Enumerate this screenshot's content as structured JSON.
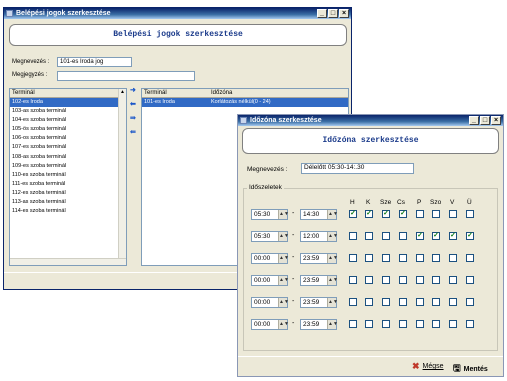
{
  "back_window": {
    "title": "Belépési jogok szerkesztése",
    "header": "Belépési jogok szerkesztése",
    "name_label": "Megnevezés :",
    "name_value": "101-es Iroda jog",
    "note_label": "Megjegyzés :",
    "note_value": "",
    "left_list": {
      "header": "Terminál",
      "items": [
        "102-es Iroda",
        "103-as szoba terminál",
        "104-es szoba terminál",
        "105-ös szoba terminál",
        "106-os szoba terminál",
        "107-es szoba terminál",
        "108-as szoba terminál",
        "109-es szoba terminál",
        "110-es szoba terminál",
        "111-es szoba terminál",
        "112-es szoba terminál",
        "113-as szoba terminál",
        "114-es szoba terminál"
      ],
      "selected_index": 0
    },
    "right_list": {
      "headers": [
        "Terminál",
        "Időzóna"
      ],
      "rows": [
        [
          "101-es Iroda",
          "Korlátozás nélkül(0 - 24)"
        ]
      ]
    },
    "move_buttons": {
      "add": "➜",
      "remove": "⬅",
      "add_all": "⇛",
      "remove_all": "⇚"
    }
  },
  "front_window": {
    "title": "Időzóna szerkesztése",
    "header": "Időzóna szerkesztése",
    "name_label": "Megnevezés :",
    "name_value": "Délelőtt 05:30-14:.30",
    "group_label": "Időszeletek",
    "days": [
      "H",
      "K",
      "Sze",
      "Cs",
      "P",
      "Szo",
      "V",
      "Ü"
    ],
    "rows": [
      {
        "from": "05:30",
        "to": "14:30",
        "checks": [
          true,
          true,
          true,
          true,
          false,
          false,
          false,
          false
        ]
      },
      {
        "from": "05:30",
        "to": "12:00",
        "checks": [
          false,
          false,
          false,
          false,
          true,
          true,
          true,
          true
        ]
      },
      {
        "from": "00:00",
        "to": "23:59",
        "checks": [
          false,
          false,
          false,
          false,
          false,
          false,
          false,
          false
        ]
      },
      {
        "from": "00:00",
        "to": "23:59",
        "checks": [
          false,
          false,
          false,
          false,
          false,
          false,
          false,
          false
        ]
      },
      {
        "from": "00:00",
        "to": "23:59",
        "checks": [
          false,
          false,
          false,
          false,
          false,
          false,
          false,
          false
        ]
      },
      {
        "from": "00:00",
        "to": "23:59",
        "checks": [
          false,
          false,
          false,
          false,
          false,
          false,
          false,
          false
        ]
      }
    ],
    "cancel_label": "Mégse",
    "save_label": "Mentés",
    "colors": {
      "cancel_icon": "#c0392b",
      "save_icon": "#1a1a1a",
      "check": "#0b7a14"
    }
  }
}
